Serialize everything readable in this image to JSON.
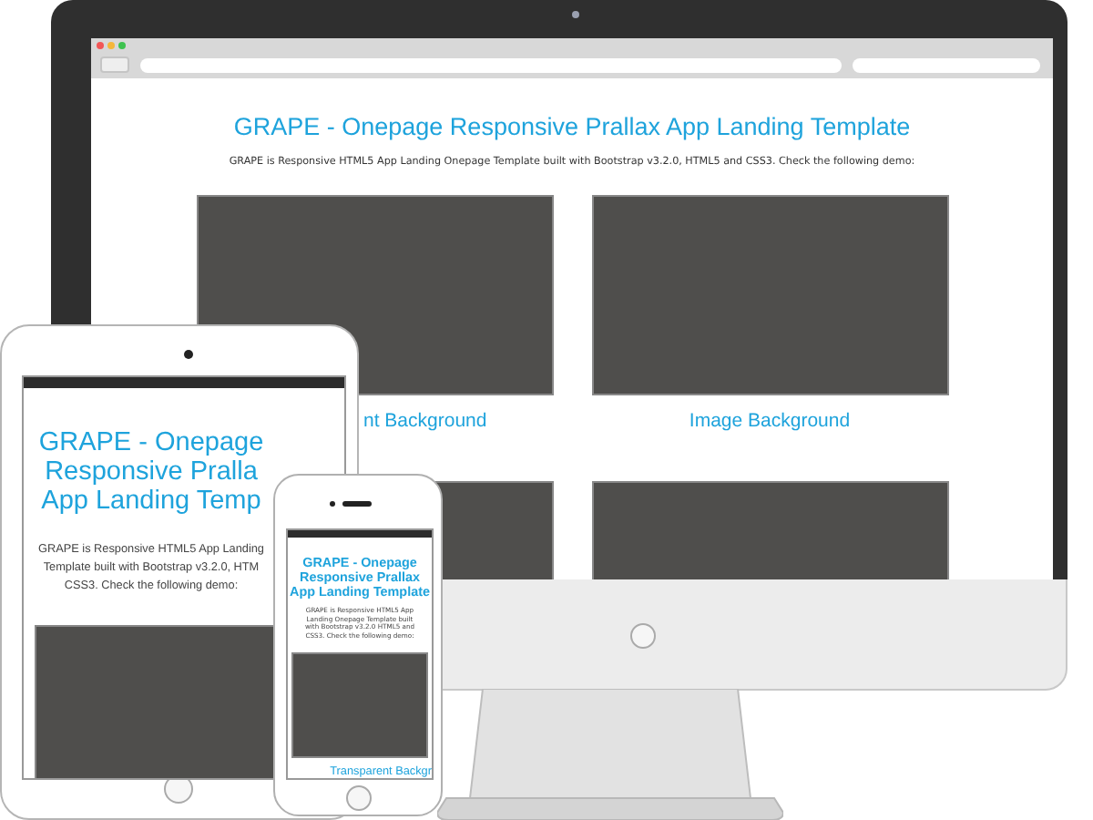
{
  "monitor": {
    "browser": {
      "page": {
        "title": "GRAPE - Onepage Responsive Prallax App Landing Template",
        "description": "GRAPE is Responsive HTML5 App Landing Onepage Template built with Bootstrap v3.2.0, HTML5 and CSS3. Check the following demo:",
        "cards": [
          {
            "kind": "labeled",
            "label": "nt Background"
          },
          {
            "kind": "labeled",
            "label": "Image Background"
          },
          {
            "kind": "cut"
          },
          {
            "kind": "cut"
          }
        ]
      }
    }
  },
  "tablet": {
    "title_lines": [
      "GRAPE - Onepage",
      "Responsive Pralla",
      "App Landing Temp"
    ],
    "description_lines": [
      "GRAPE is Responsive HTML5 App Landing",
      "Template built with Bootstrap v3.2.0, HTM",
      "CSS3. Check the following demo:"
    ]
  },
  "phone": {
    "title_lines": [
      "GRAPE - Onepage",
      "Responsive Prallax",
      "App Landing Template"
    ],
    "description": "GRAPE is Responsive HTML5 App Landing Onepage Template built with Bootstrap v3.2.0 HTML5 and CSS3. Check the following demo:",
    "card_label": "Transparent Backgr"
  }
}
